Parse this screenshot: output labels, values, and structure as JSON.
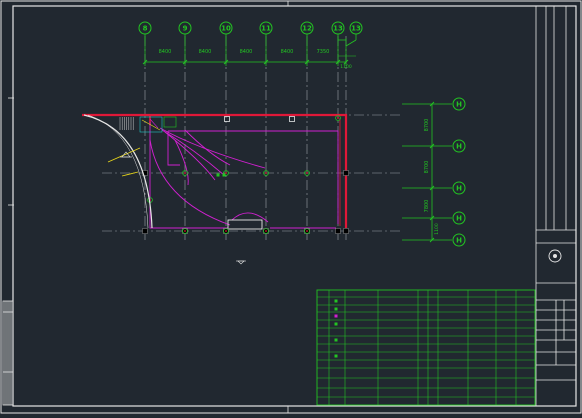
{
  "colors": {
    "background": "#212830",
    "frame": "#e6e6e6",
    "grid_bubble": "#22c522",
    "dimension": "#22c522",
    "wall": "#e01838",
    "pipe": "#d020d0",
    "axis": "#9aa0a6",
    "annotation": "#e6d51a",
    "table": "#22c522"
  },
  "drawing": {
    "top_axes": [
      "8",
      "9",
      "10",
      "11",
      "12",
      "13",
      "13"
    ],
    "top_dimensions": [
      "8400",
      "8400",
      "8400",
      "8400",
      "7350"
    ],
    "top_small_dimension": "1100",
    "right_axes": [
      "H",
      "H",
      "H",
      "H",
      "H"
    ],
    "right_dimensions": [
      "8700",
      "8700",
      "7800"
    ],
    "right_small_dimension": "1100",
    "north_arrow_icon": "north-arrow-icon",
    "section_marker_icon": "section-marker-icon"
  }
}
